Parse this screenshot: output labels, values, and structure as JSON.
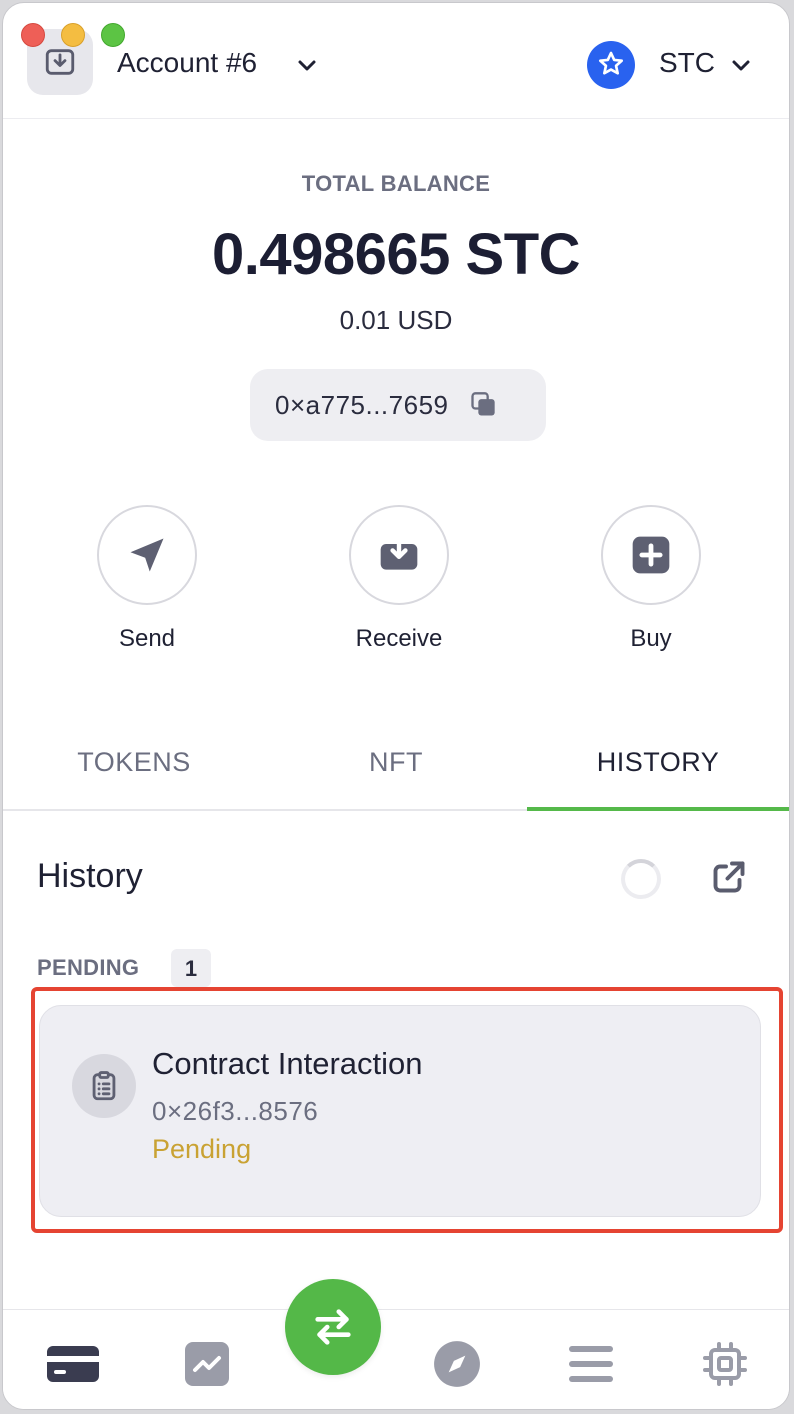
{
  "header": {
    "account_name": "Account #6",
    "network_name": "STC"
  },
  "balance": {
    "label": "TOTAL BALANCE",
    "value": "0.498665 STC",
    "fiat": "0.01 USD",
    "address": "0×a775...7659"
  },
  "actions": [
    {
      "label": "Send",
      "icon": "send-icon"
    },
    {
      "label": "Receive",
      "icon": "receive-icon"
    },
    {
      "label": "Buy",
      "icon": "buy-icon"
    }
  ],
  "tabs": [
    {
      "label": "TOKENS",
      "active": false
    },
    {
      "label": "NFT",
      "active": false
    },
    {
      "label": "HISTORY",
      "active": true
    }
  ],
  "history": {
    "title": "History",
    "pending_label": "PENDING",
    "pending_count": "1",
    "items": [
      {
        "title": "Contract Interaction",
        "address": "0×26f3...8576",
        "status": "Pending"
      }
    ]
  },
  "bottom_nav": [
    "wallet-icon",
    "chart-icon",
    "swap-icon",
    "compass-icon",
    "menu-icon",
    "chip-icon"
  ],
  "colors": {
    "accent_green": "#54b848",
    "pending_yellow": "#c9a233",
    "network_blue": "#2962ef",
    "highlight_red": "#e54432"
  }
}
